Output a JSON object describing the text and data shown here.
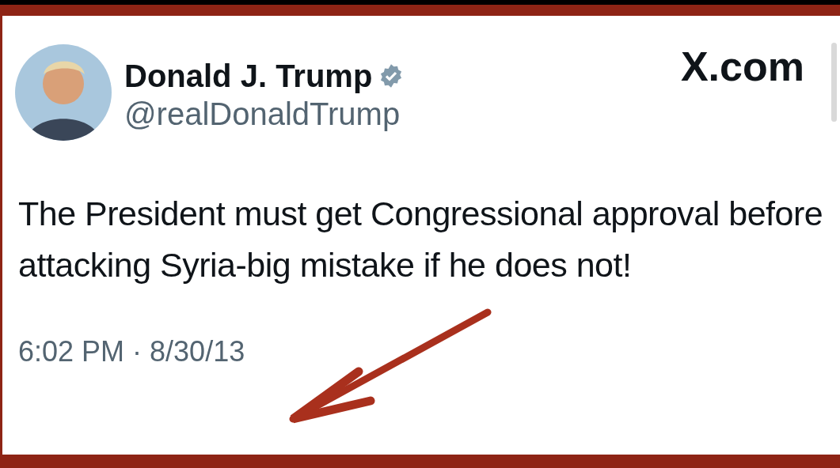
{
  "post": {
    "author_name": "Donald J. Trump",
    "verified": true,
    "handle": "@realDonaldTrump",
    "site": "X.com",
    "text": "The President must get Congressional approval before attacking Syria-big mistake if he does not!",
    "time": "6:02 PM · 8/30/13"
  }
}
